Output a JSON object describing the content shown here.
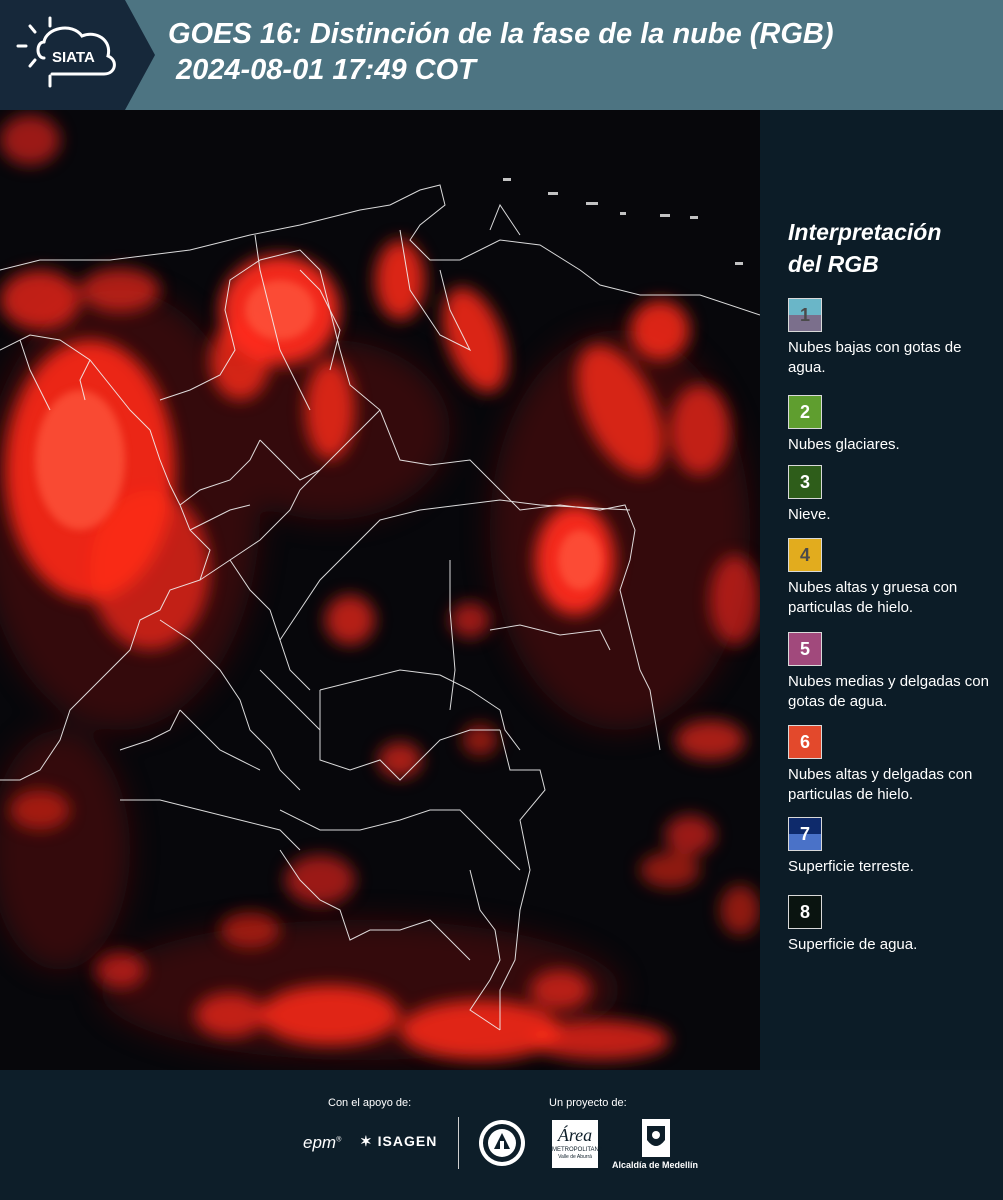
{
  "header": {
    "logo_text": "SIATA",
    "title_line1": "GOES 16: Distinción de la fase de la nube (RGB)",
    "title_line2": "2024-08-01 17:49 COT"
  },
  "legend": {
    "title_line1": "Interpretación",
    "title_line2": "del RGB",
    "items": [
      {
        "num": "1",
        "label": "Nubes bajas con gotas de agua.",
        "color_top": "#6ab6c8",
        "color_bottom": "#7b6f8c",
        "num_color": "#4a4a4a"
      },
      {
        "num": "2",
        "label": "Nubes glaciares.",
        "color_top": "#5f9e2f",
        "color_bottom": "#5f9e2f",
        "num_color": "#ffffff"
      },
      {
        "num": "3",
        "label": "Nieve.",
        "color_top": "#2e5d1a",
        "color_bottom": "#2e5d1a",
        "num_color": "#ffffff"
      },
      {
        "num": "4",
        "label": "Nubes altas y gruesa con particulas de hielo.",
        "color_top": "#e2ac1e",
        "color_bottom": "#e2ac1e",
        "num_color": "#4a4a4a"
      },
      {
        "num": "5",
        "label": "Nubes medias y delgadas con gotas de agua.",
        "color_top": "#a1497c",
        "color_bottom": "#a1497c",
        "num_color": "#ffffff"
      },
      {
        "num": "6",
        "label": "Nubes altas y delgadas con particulas de hielo.",
        "color_top": "#e3492c",
        "color_bottom": "#e3492c",
        "num_color": "#ffffff"
      },
      {
        "num": "7",
        "label": "Superficie terreste.",
        "color_top": "#0e2a6b",
        "color_bottom": "#4a72c8",
        "num_color": "#ffffff"
      },
      {
        "num": "8",
        "label": "Superficie de agua.",
        "color_top": "#0a1410",
        "color_bottom": "#0a1410",
        "num_color": "#ffffff"
      }
    ]
  },
  "footer": {
    "support_label": "Con el apoyo de:",
    "project_label": "Un proyecto de:",
    "epm": "epm",
    "isagen": "ISAGEN",
    "area_main": "Área",
    "area_sub1": "METROPOLITANA",
    "area_sub2": "Valle de Aburrá",
    "alcaldia": "Alcaldía de Medellín"
  }
}
